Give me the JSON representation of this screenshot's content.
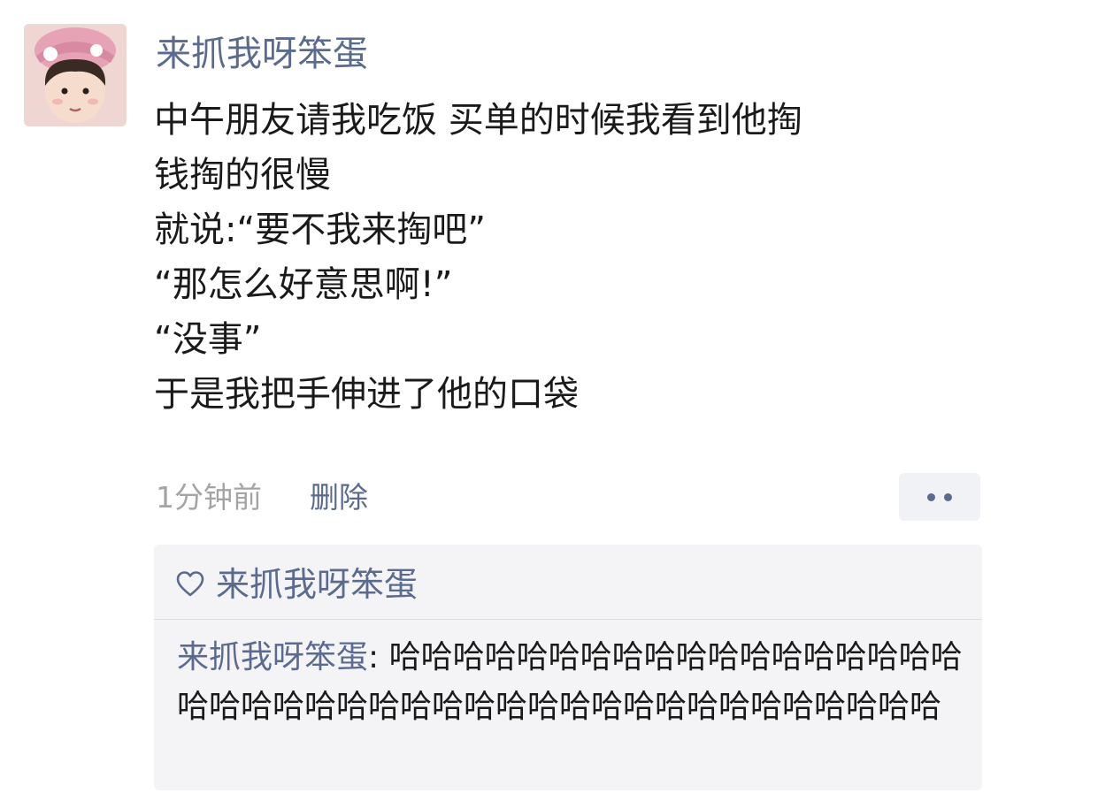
{
  "post": {
    "author": "来抓我呀笨蛋",
    "lines": [
      "中午朋友请我吃饭 买单的时候我看到他掏",
      "钱掏的很慢",
      "就说:“要不我来掏吧”",
      "“那怎么好意思啊!”",
      "“没事”",
      "于是我把手伸进了他的口袋"
    ],
    "time": "1分钟前",
    "delete_label": "删除",
    "more_icon": "more-dots-icon"
  },
  "likes": {
    "icon": "heart-icon",
    "names": "来抓我呀笨蛋"
  },
  "comment": {
    "author": "来抓我呀笨蛋",
    "separator": ": ",
    "text": "哈哈哈哈哈哈哈哈哈哈哈哈哈哈哈哈哈哈哈哈哈哈哈哈哈哈哈哈哈哈哈哈哈哈哈哈哈哈哈哈哈哈"
  },
  "colors": {
    "link": "#5b6b8f",
    "text": "#1a1a1a",
    "muted": "#a4a4a4",
    "panel": "#f4f4f6"
  }
}
